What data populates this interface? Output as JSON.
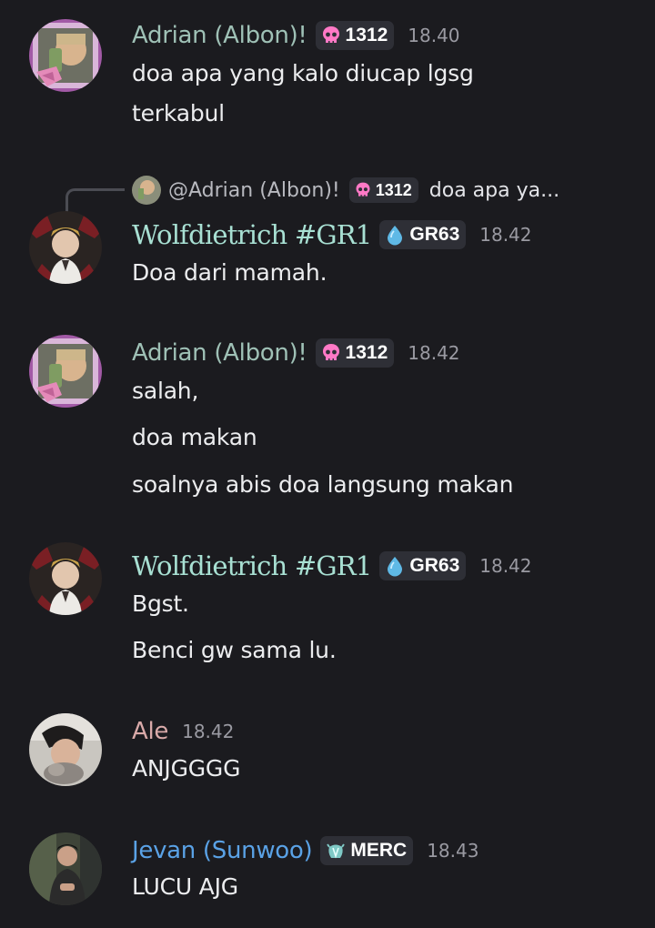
{
  "messages": [
    {
      "author": "Adrian (Albon)!",
      "tag": {
        "icon": "pink-skull-icon",
        "label": "1312"
      },
      "time": "18.40",
      "lines": [
        "doa apa yang kalo diucap lgsg",
        "terkabul"
      ]
    },
    {
      "reply": {
        "author": "@Adrian (Albon)!",
        "tag": {
          "icon": "pink-skull-icon",
          "label": "1312"
        },
        "preview": "doa apa ya..."
      },
      "author": "Wolfdietrich #GR1",
      "tag": {
        "icon": "water-drop-icon",
        "label": "GR63"
      },
      "time": "18.42",
      "lines": [
        "Doa dari mamah."
      ]
    },
    {
      "author": "Adrian (Albon)!",
      "tag": {
        "icon": "pink-skull-icon",
        "label": "1312"
      },
      "time": "18.42",
      "lines": [
        "salah,",
        "doa makan",
        "soalnya abis doa langsung makan"
      ]
    },
    {
      "author": "Wolfdietrich #GR1",
      "tag": {
        "icon": "water-drop-icon",
        "label": "GR63"
      },
      "time": "18.42",
      "lines": [
        "Bgst.",
        "Benci gw sama lu."
      ]
    },
    {
      "author": "Ale",
      "time": "18.42",
      "lines": [
        "ANJGGGG"
      ]
    },
    {
      "author": "Jevan (Sunwoo)",
      "tag": {
        "icon": "crystal-icon",
        "label": "MERC"
      },
      "time": "18.43",
      "lines": [
        "LUCU AJG"
      ]
    }
  ],
  "colors": {
    "background": "#1b1b1f",
    "adrian_name": "#9fc1b6",
    "wolf_name": "#a8e0d3",
    "ale_name": "#d9aaa9",
    "jevan_name": "#5aa2e6",
    "tag_bg": "#2e2f36",
    "timestamp": "#9a9aa2"
  }
}
